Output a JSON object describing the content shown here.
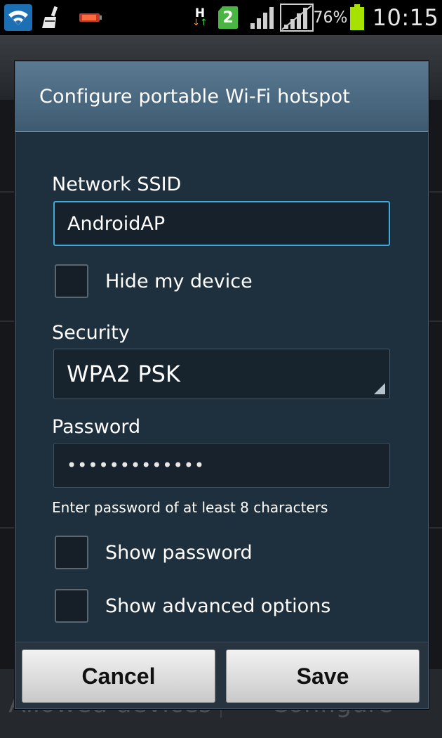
{
  "status_bar": {
    "network_type": "H",
    "sim_slot": "2",
    "battery_percent": "76%",
    "time": "10:15",
    "icons": [
      "wifi-icon",
      "cleaner-icon",
      "battery-app-icon",
      "data-activity-icon",
      "sim-icon",
      "signal-icon",
      "signal-icon-2",
      "battery-icon"
    ],
    "colors": {
      "wifi_bg": "#1d6fb3",
      "sim_badge": "#4bb543",
      "battery_fill": "#a6e100"
    }
  },
  "background_app": {
    "bottom_buttons": [
      "Allowed devices",
      "Configure"
    ]
  },
  "dialog": {
    "title": "Configure portable Wi-Fi hotspot",
    "ssid_label": "Network SSID",
    "ssid_value": "AndroidAP",
    "hide_device_label": "Hide my device",
    "hide_device_checked": false,
    "security_label": "Security",
    "security_value": "WPA2 PSK",
    "password_label": "Password",
    "password_value": "•••••••••••••",
    "password_hint": "Enter password of at least 8 characters",
    "show_password_label": "Show password",
    "show_password_checked": false,
    "show_advanced_label": "Show advanced options",
    "show_advanced_checked": false,
    "cancel_label": "Cancel",
    "save_label": "Save",
    "colors": {
      "header": "#4a6a82",
      "body": "#1e2f3d",
      "focus_border": "#41a9d9"
    }
  }
}
